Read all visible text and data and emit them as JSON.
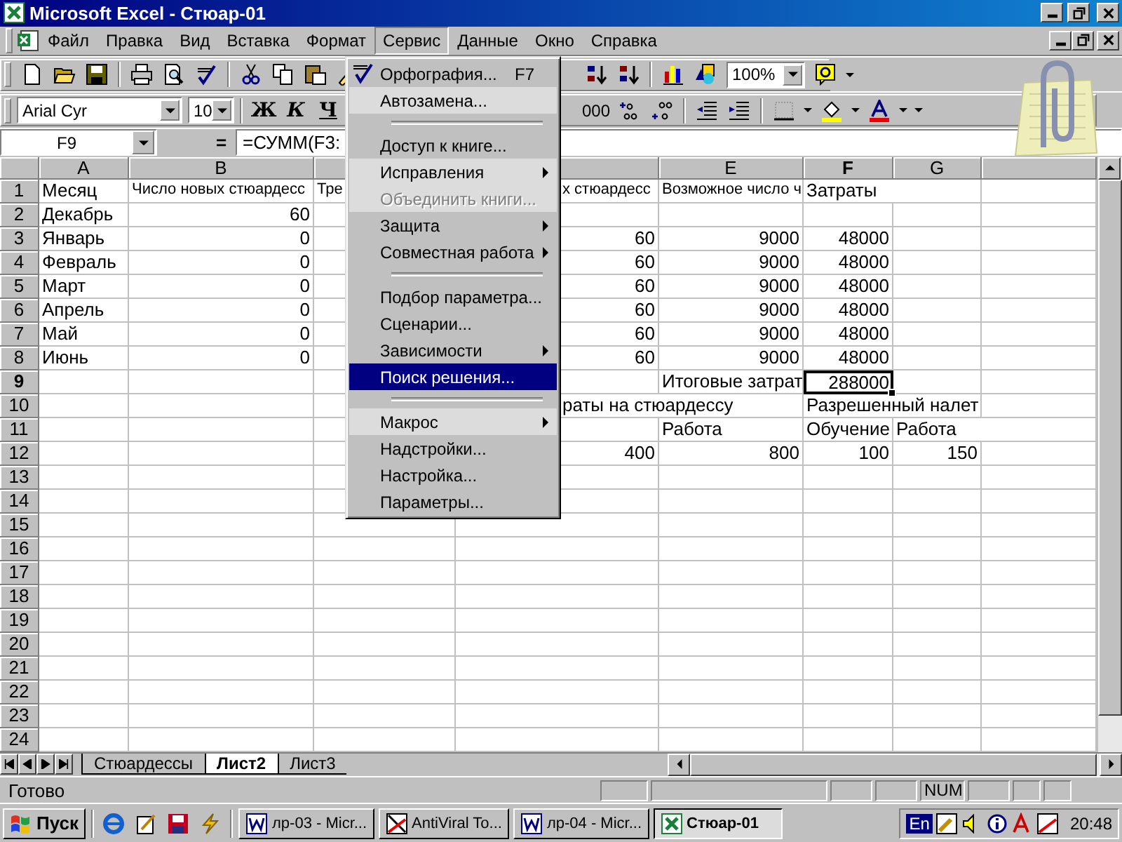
{
  "window": {
    "title": "Microsoft Excel - Стюар-01"
  },
  "menu_bar": [
    {
      "label": "Файл",
      "selected": false
    },
    {
      "label": "Правка",
      "selected": false
    },
    {
      "label": "Вид",
      "selected": false
    },
    {
      "label": "Вставка",
      "selected": false
    },
    {
      "label": "Формат",
      "selected": false
    },
    {
      "label": "Сервис",
      "selected": true
    },
    {
      "label": "Данные",
      "selected": false
    },
    {
      "label": "Окно",
      "selected": false
    },
    {
      "label": "Справка",
      "selected": false
    }
  ],
  "toolbar": {
    "zoom": "100%"
  },
  "format_toolbar": {
    "font": "Arial Cyr",
    "size": "10",
    "bold": "Ж",
    "italic": "К",
    "underline": "Ч",
    "thousands": "000"
  },
  "formula_bar": {
    "name_box": "F9",
    "equals": "=",
    "formula": "=СУММ(F3:"
  },
  "tools_menu": [
    {
      "kind": "icon_item",
      "label": "Орфография...",
      "shortcut": "F7",
      "submenu": false,
      "disabled": false,
      "rarely_used": false,
      "selected": false
    },
    {
      "kind": "item",
      "label": "Автозамена...",
      "submenu": false,
      "disabled": false,
      "rarely_used": true,
      "selected": false
    },
    {
      "kind": "separator"
    },
    {
      "kind": "item",
      "label": "Доступ к книге...",
      "submenu": false,
      "disabled": false,
      "rarely_used": false,
      "selected": false
    },
    {
      "kind": "item",
      "label": "Исправления",
      "submenu": true,
      "disabled": false,
      "rarely_used": true,
      "selected": false
    },
    {
      "kind": "item",
      "label": "Объединить книги...",
      "submenu": false,
      "disabled": true,
      "rarely_used": true,
      "selected": false
    },
    {
      "kind": "item",
      "label": "Защита",
      "submenu": true,
      "disabled": false,
      "rarely_used": false,
      "selected": false
    },
    {
      "kind": "item",
      "label": "Совместная работа",
      "submenu": true,
      "disabled": false,
      "rarely_used": false,
      "selected": false
    },
    {
      "kind": "separator"
    },
    {
      "kind": "item",
      "label": "Подбор параметра...",
      "submenu": false,
      "disabled": false,
      "rarely_used": false,
      "selected": false
    },
    {
      "kind": "item",
      "label": "Сценарии...",
      "submenu": false,
      "disabled": false,
      "rarely_used": false,
      "selected": false
    },
    {
      "kind": "item",
      "label": "Зависимости",
      "submenu": true,
      "disabled": false,
      "rarely_used": false,
      "selected": false
    },
    {
      "kind": "item",
      "label": "Поиск решения...",
      "submenu": false,
      "disabled": false,
      "rarely_used": false,
      "selected": true
    },
    {
      "kind": "separator"
    },
    {
      "kind": "item",
      "label": "Макрос",
      "submenu": true,
      "disabled": false,
      "rarely_used": true,
      "selected": false
    },
    {
      "kind": "item",
      "label": "Надстройки...",
      "submenu": false,
      "disabled": false,
      "rarely_used": false,
      "selected": false
    },
    {
      "kind": "item",
      "label": "Настройка...",
      "submenu": false,
      "disabled": false,
      "rarely_used": false,
      "selected": false
    },
    {
      "kind": "item",
      "label": "Параметры...",
      "submenu": false,
      "disabled": false,
      "rarely_used": false,
      "selected": false
    }
  ],
  "columns": {
    "A": {
      "label": "A",
      "selected": false
    },
    "B": {
      "label": "B",
      "selected": false
    },
    "E": {
      "label": "E",
      "selected": false
    },
    "F": {
      "label": "F",
      "selected": true
    },
    "G": {
      "label": "G",
      "selected": false
    }
  },
  "rows": [
    {
      "label": "1",
      "selected": false,
      "cells": {
        "A": {
          "text": "Месяц",
          "kind": "text",
          "selected": false
        },
        "B": {
          "text": "Число новых стюардесс",
          "kind": "label",
          "selected": false
        },
        "C": {
          "text": "Тре",
          "kind": "label",
          "selected": false
        },
        "D": {
          "text": "х стюардесс",
          "kind": "label",
          "selected": false
        },
        "E": {
          "text": "Возможное число ч",
          "kind": "label",
          "selected": false
        },
        "F": {
          "text": "Затраты",
          "kind": "text",
          "selected": false
        }
      }
    },
    {
      "label": "2",
      "selected": false,
      "cells": {
        "A": {
          "text": "Декабрь",
          "kind": "text",
          "selected": false
        },
        "B": {
          "text": "60",
          "kind": "number",
          "selected": false
        }
      }
    },
    {
      "label": "3",
      "selected": false,
      "cells": {
        "A": {
          "text": "Январь",
          "kind": "text",
          "selected": false
        },
        "B": {
          "text": "0",
          "kind": "number",
          "selected": false
        },
        "D": {
          "text": "60",
          "kind": "number",
          "selected": false
        },
        "E": {
          "text": "9000",
          "kind": "number",
          "selected": false
        },
        "F": {
          "text": "48000",
          "kind": "number",
          "selected": false
        }
      }
    },
    {
      "label": "4",
      "selected": false,
      "cells": {
        "A": {
          "text": "Февраль",
          "kind": "text",
          "selected": false
        },
        "B": {
          "text": "0",
          "kind": "number",
          "selected": false
        },
        "D": {
          "text": "60",
          "kind": "number",
          "selected": false
        },
        "E": {
          "text": "9000",
          "kind": "number",
          "selected": false
        },
        "F": {
          "text": "48000",
          "kind": "number",
          "selected": false
        }
      }
    },
    {
      "label": "5",
      "selected": false,
      "cells": {
        "A": {
          "text": "Март",
          "kind": "text",
          "selected": false
        },
        "B": {
          "text": "0",
          "kind": "number",
          "selected": false
        },
        "D": {
          "text": "60",
          "kind": "number",
          "selected": false
        },
        "E": {
          "text": "9000",
          "kind": "number",
          "selected": false
        },
        "F": {
          "text": "48000",
          "kind": "number",
          "selected": false
        }
      }
    },
    {
      "label": "6",
      "selected": false,
      "cells": {
        "A": {
          "text": "Апрель",
          "kind": "text",
          "selected": false
        },
        "B": {
          "text": "0",
          "kind": "number",
          "selected": false
        },
        "D": {
          "text": "60",
          "kind": "number",
          "selected": false
        },
        "E": {
          "text": "9000",
          "kind": "number",
          "selected": false
        },
        "F": {
          "text": "48000",
          "kind": "number",
          "selected": false
        }
      }
    },
    {
      "label": "7",
      "selected": false,
      "cells": {
        "A": {
          "text": "Май",
          "kind": "text",
          "selected": false
        },
        "B": {
          "text": "0",
          "kind": "number",
          "selected": false
        },
        "D": {
          "text": "60",
          "kind": "number",
          "selected": false
        },
        "E": {
          "text": "9000",
          "kind": "number",
          "selected": false
        },
        "F": {
          "text": "48000",
          "kind": "number",
          "selected": false
        }
      }
    },
    {
      "label": "8",
      "selected": false,
      "cells": {
        "A": {
          "text": "Июнь",
          "kind": "text",
          "selected": false
        },
        "B": {
          "text": "0",
          "kind": "number",
          "selected": false
        },
        "D": {
          "text": "60",
          "kind": "number",
          "selected": false
        },
        "E": {
          "text": "9000",
          "kind": "number",
          "selected": false
        },
        "F": {
          "text": "48000",
          "kind": "number",
          "selected": false
        }
      }
    },
    {
      "label": "9",
      "selected": true,
      "cells": {
        "E": {
          "text": "Итоговые затрат",
          "kind": "text",
          "selected": false
        },
        "F": {
          "text": "288000",
          "kind": "number",
          "selected": true
        }
      }
    },
    {
      "label": "10",
      "selected": false,
      "cells": {
        "D": {
          "text": "раты на стюардессу",
          "kind": "text",
          "selected": false
        },
        "F": {
          "text": "Разрешенный налет",
          "kind": "text",
          "selected": false
        }
      }
    },
    {
      "label": "11",
      "selected": false,
      "cells": {
        "E": {
          "text": "Работа",
          "kind": "text",
          "selected": false
        },
        "F": {
          "text": "Обучение",
          "kind": "text",
          "selected": false
        },
        "G": {
          "text": "Работа",
          "kind": "text",
          "selected": false
        }
      }
    },
    {
      "label": "12",
      "selected": false,
      "cells": {
        "D": {
          "text": "400",
          "kind": "number",
          "selected": false
        },
        "E": {
          "text": "800",
          "kind": "number",
          "selected": false
        },
        "F": {
          "text": "100",
          "kind": "number",
          "selected": false
        },
        "G": {
          "text": "150",
          "kind": "number",
          "selected": false
        }
      }
    },
    {
      "label": "13",
      "selected": false,
      "cells": {}
    },
    {
      "label": "14",
      "selected": false,
      "cells": {}
    },
    {
      "label": "15",
      "selected": false,
      "cells": {}
    },
    {
      "label": "16",
      "selected": false,
      "cells": {}
    },
    {
      "label": "17",
      "selected": false,
      "cells": {}
    },
    {
      "label": "18",
      "selected": false,
      "cells": {}
    },
    {
      "label": "19",
      "selected": false,
      "cells": {}
    },
    {
      "label": "20",
      "selected": false,
      "cells": {}
    },
    {
      "label": "21",
      "selected": false,
      "cells": {}
    },
    {
      "label": "22",
      "selected": false,
      "cells": {}
    },
    {
      "label": "23",
      "selected": false,
      "cells": {}
    },
    {
      "label": "24",
      "selected": false,
      "cells": {}
    }
  ],
  "sheet_tabs": [
    {
      "label": "Стюардессы",
      "selected": false
    },
    {
      "label": "Лист2",
      "selected": true
    },
    {
      "label": "Лист3",
      "selected": false
    }
  ],
  "status_bar": {
    "text": "Готово",
    "indicator": "NUM"
  },
  "taskbar": {
    "start": "Пуск",
    "language": "En",
    "clock": "20:48",
    "tasks": [
      {
        "label": "лр-03 - Micr...",
        "kind": "word",
        "selected": false
      },
      {
        "label": "AntiViral To...",
        "kind": "antivirus",
        "selected": false
      },
      {
        "label": "лр-04 - Micr...",
        "kind": "word",
        "selected": false
      },
      {
        "label": "Стюар-01",
        "kind": "excel",
        "selected": true
      }
    ]
  }
}
